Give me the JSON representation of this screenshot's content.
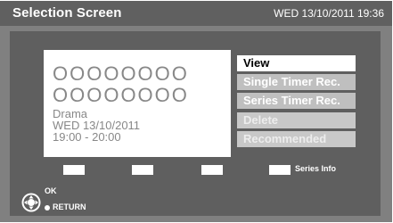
{
  "header": {
    "title": "Selection Screen",
    "datetime": "WED 13/10/2011 19:36"
  },
  "program_info": {
    "title_line_1": "OOOOOOOO",
    "title_line_2": "OOOOOOOO",
    "genre": "Drama",
    "date": "WED 13/10/2011",
    "time": "19:00 - 20:00"
  },
  "menu": {
    "items": [
      {
        "label": "View",
        "state": "selected"
      },
      {
        "label": "Single Timer Rec.",
        "state": "enabled"
      },
      {
        "label": "Series Timer Rec.",
        "state": "enabled"
      },
      {
        "label": "Delete",
        "state": "disabled"
      },
      {
        "label": "Recommended",
        "state": "disabled"
      }
    ]
  },
  "color_keys": {
    "series_info_label": "Series Info"
  },
  "footer": {
    "ok_label": "OK",
    "return_label": "RETURN"
  },
  "colors": {
    "background": "#808080",
    "header": "#606060",
    "panel": "#5f5f5f",
    "menu_selected": "#ffffff",
    "menu_enabled": "#bfbfbf",
    "menu_disabled": "#c8c8c8"
  }
}
